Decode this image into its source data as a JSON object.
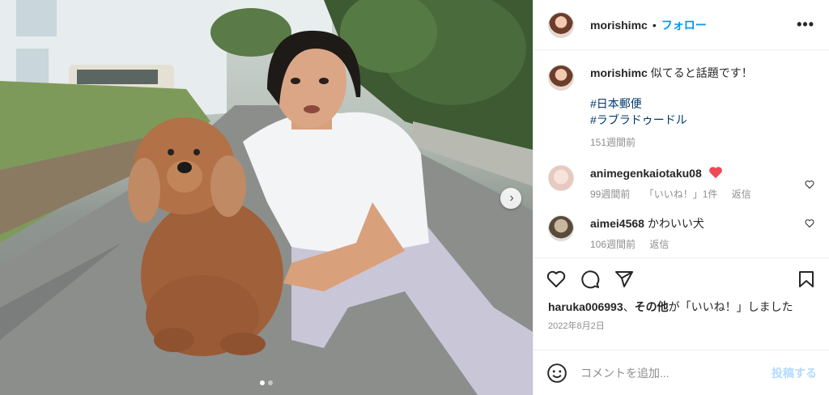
{
  "header": {
    "username": "morishimc",
    "separator": "•",
    "follow_label": "フォロー",
    "more_label": "•••"
  },
  "caption": {
    "username": "morishimc",
    "text": "似てると話題です！",
    "hashtags": [
      "#日本郵便",
      "#ラブラドゥードル"
    ],
    "time": "151週間前"
  },
  "comments": [
    {
      "username": "animegenkaiotaku08",
      "text": "",
      "time": "99週間前",
      "likes": "「いいね！」1件",
      "reply": "返信"
    },
    {
      "username": "aimei4568",
      "text": "かわいい犬",
      "time": "106週間前",
      "reply": "返信"
    }
  ],
  "likes_line": {
    "user": "haruka006993",
    "mid": "、",
    "others": "その他",
    "tail": "が「いいね！」しました"
  },
  "post_date": "2022年8月2日",
  "add_comment": {
    "placeholder": "コメントを追加...",
    "post_label": "投稿する"
  },
  "photo": {
    "carousel_count": 2,
    "current_index": 0
  },
  "colors": {
    "link": "#0095f6",
    "hashtag": "#00376b",
    "like_red": "#ed4956"
  }
}
